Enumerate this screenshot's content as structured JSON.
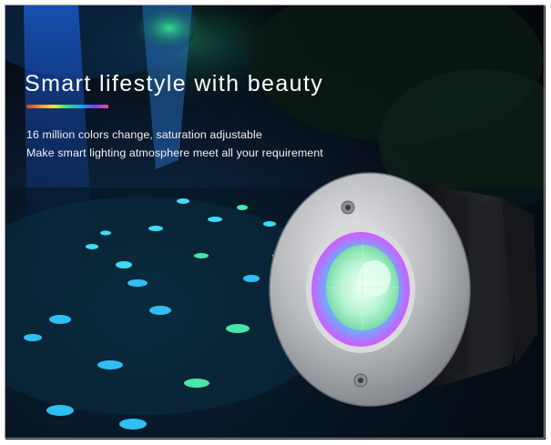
{
  "banner": {
    "headline": "Smart lifestyle with beauty",
    "feature_line_1": "16 million colors change, saturation adjustable",
    "feature_line_2": "Make smart lighting atmosphere meet all your requirement"
  },
  "colors": {
    "background": "#06090f",
    "headline_text": "#ffffff",
    "rainbow_bar": [
      "#ff2a2a",
      "#ff9a1a",
      "#ffe81a",
      "#2ee85a",
      "#1aa8ff",
      "#7a3cff",
      "#ff3cc8"
    ],
    "steel_housing": "#c9cbcc",
    "lamp_body": "#1a1c1f"
  },
  "icons": {
    "fixture": "inground-rgb-spotlight",
    "screws": "mounting-screw-icon"
  }
}
